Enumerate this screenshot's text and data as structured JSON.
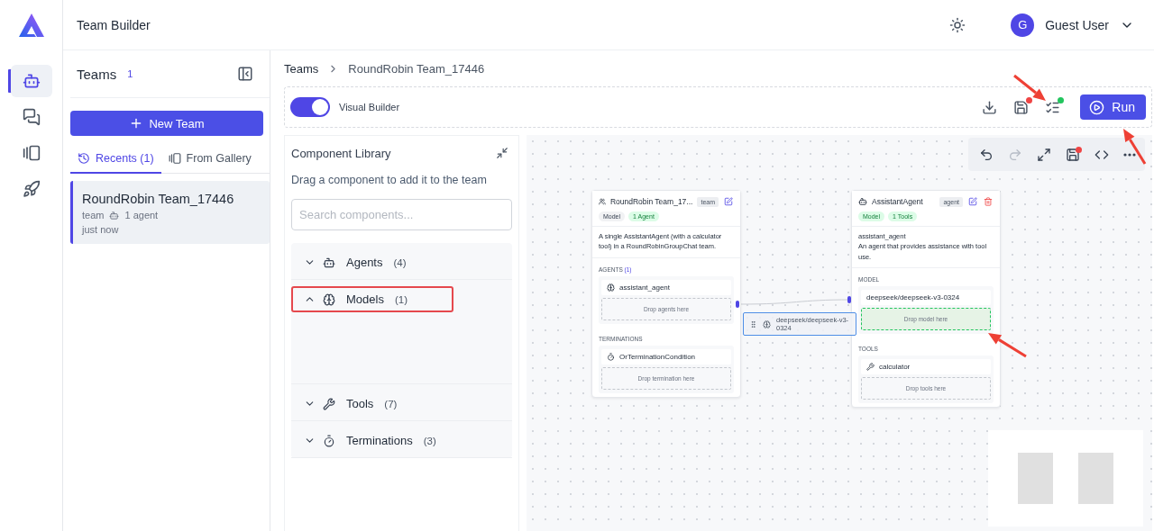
{
  "app": {
    "title": "Team Builder",
    "user": {
      "initial": "G",
      "name": "Guest User"
    }
  },
  "nav": [
    {
      "kind": "bot",
      "selected": true
    },
    {
      "kind": "chat",
      "selected": false
    },
    {
      "kind": "gallery",
      "selected": false
    },
    {
      "kind": "deploy",
      "selected": false
    }
  ],
  "teams_panel": {
    "title": "Teams",
    "count": "1",
    "new_button": "New Team",
    "tabs": [
      {
        "kind": "history",
        "label": "Recents (1)",
        "selected": true
      },
      {
        "kind": "gallery",
        "label": "From Gallery",
        "selected": false
      }
    ],
    "items": [
      {
        "name": "RoundRobin Team_17446",
        "type": "team",
        "agents": "1 agent",
        "time": "just now",
        "selected": true
      }
    ]
  },
  "breadcrumb": [
    "Teams",
    "RoundRobin Team_17446"
  ],
  "toolbar": {
    "toggle": {
      "label": "Visual Builder",
      "on": true
    },
    "actions": [
      {
        "kind": "download"
      },
      {
        "kind": "save",
        "color": "#ef4444"
      },
      {
        "kind": "validate",
        "color": "#22c55e"
      }
    ],
    "run_button": "Run"
  },
  "library": {
    "title": "Component Library",
    "subtitle": "Drag a component to add it to the team",
    "search": {
      "placeholder": "Search components..."
    },
    "sections": [
      {
        "kind": "agents",
        "label": "Agents",
        "count": "(4)",
        "expanded": false,
        "highlighted": false
      },
      {
        "kind": "models",
        "label": "Models",
        "count": "(1)",
        "expanded": true,
        "highlighted": true
      },
      {
        "kind": "tools",
        "label": "Tools",
        "count": "(7)",
        "expanded": false,
        "highlighted": false
      },
      {
        "kind": "terminations",
        "label": "Terminations",
        "count": "(3)",
        "expanded": false,
        "highlighted": false
      }
    ]
  },
  "canvas": {
    "tools": [
      {
        "kind": "undo",
        "disabled": false
      },
      {
        "kind": "redo",
        "disabled": true
      },
      {
        "kind": "fit",
        "disabled": false
      },
      {
        "kind": "save",
        "disabled": false,
        "color": "#ef4444"
      },
      {
        "kind": "code",
        "disabled": false
      },
      {
        "kind": "more",
        "disabled": false
      }
    ],
    "nodes": [
      {
        "kind": "team",
        "title": "RoundRobin Team_17...",
        "badge": "team",
        "deletable": false,
        "tags": [
          {
            "label": "Model",
            "color": "#f1f2f4"
          },
          {
            "label": "1 Agent",
            "color": "#dcfce7"
          }
        ],
        "description": "A single AssistantAgent (with a calculator tool) in a RoundRobinGroupChat team.",
        "sections": [
          {
            "title": "AGENTS",
            "count": "(1)",
            "items": [
              {
                "kind": "agent",
                "label": "assistant_agent"
              }
            ],
            "drop": "Drop agents here",
            "drop_active": false
          },
          {
            "title": "TERMINATIONS",
            "items": [
              {
                "kind": "termination",
                "label": "OrTerminationCondition"
              }
            ],
            "drop": "Drop termination here",
            "drop_active": false
          }
        ]
      },
      {
        "kind": "agent",
        "title": "AssistantAgent",
        "badge": "agent",
        "deletable": true,
        "tags": [
          {
            "label": "Model",
            "color": "#dcfce7"
          },
          {
            "label": "1 Tools",
            "color": "#dcfce7"
          }
        ],
        "subtitle": "assistant_agent",
        "description": "An agent that provides assistance with tool use.",
        "sections": [
          {
            "title": "MODEL",
            "items": [
              {
                "kind": "model",
                "label": "deepseek/deepseek-v3-0324"
              }
            ],
            "drop": "Drop model here",
            "drop_active": true
          },
          {
            "title": "TOOLS",
            "items": [
              {
                "kind": "tool",
                "label": "calculator"
              }
            ],
            "drop": "Drop tools here",
            "drop_active": false
          }
        ]
      }
    ],
    "drag_ghost": {
      "label": "deepseek/deepseek-v3-0324"
    }
  }
}
